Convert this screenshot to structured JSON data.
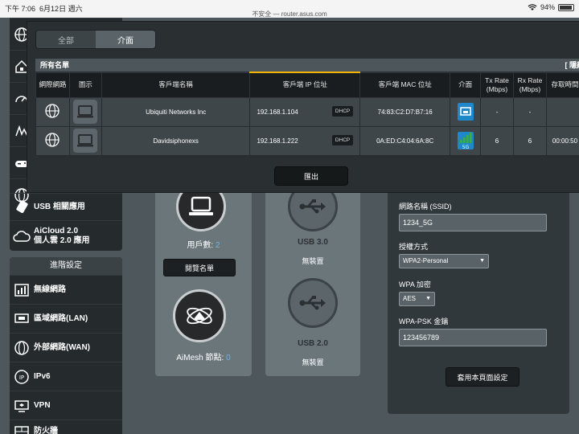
{
  "status_bar": {
    "time": "下午 7:06",
    "date": "6月12日 週六",
    "url": "不安全 — router.asus.com",
    "battery": "94%"
  },
  "sidebar": {
    "items": [
      {
        "label": "",
        "icon": "globe-icon"
      },
      {
        "label": "",
        "icon": "lock-home-icon"
      },
      {
        "label": "",
        "icon": "speedometer-icon"
      },
      {
        "label": "",
        "icon": "signal-icon"
      },
      {
        "label": "",
        "icon": "gamepad-icon"
      },
      {
        "label": "",
        "icon": "globe-icon"
      },
      {
        "label": "USB 相關應用",
        "icon": "usb-icon"
      },
      {
        "label": "AiCloud 2.0\n個人雲 2.0 應用",
        "icon": "cloud-icon"
      }
    ],
    "advanced_header": "進階設定",
    "advanced_items": [
      {
        "label": "無線網路",
        "icon": "wifi-icon"
      },
      {
        "label": "區域網路(LAN)",
        "icon": "lan-icon"
      },
      {
        "label": "外部網路(WAN)",
        "icon": "wan-globe-icon"
      },
      {
        "label": "IPv6",
        "icon": "ipv6-icon"
      },
      {
        "label": "VPN",
        "icon": "vpn-icon"
      },
      {
        "label": "防火牆",
        "icon": "firewall-icon"
      }
    ]
  },
  "clients_panel": {
    "count_label": "用戶數:",
    "count": "2",
    "view_list_button": "閱覽名單",
    "aimesh_label": "AiMesh 節點:",
    "aimesh_count": "0"
  },
  "usb_panel": {
    "usb3_title": "USB 3.0",
    "usb3_status": "無裝置",
    "usb2_title": "USB 2.0",
    "usb2_status": "無裝置"
  },
  "wireless_panel": {
    "ssid_label": "網路名稱 (SSID)",
    "ssid_value": "1234_5G",
    "auth_label": "授權方式",
    "auth_value": "WPA2-Personal",
    "wpa_label": "WPA 加密",
    "wpa_value": "AES",
    "psk_label": "WPA-PSK 金鑰",
    "psk_value": "123456789",
    "apply_button": "套用本頁面設定"
  },
  "modal": {
    "tabs": [
      {
        "label": "全部",
        "active": false
      },
      {
        "label": "介面",
        "active": true
      }
    ],
    "list_title": "所有名單",
    "hide_label": "[ 隱藏",
    "columns": [
      "網際網路",
      "圖示",
      "客戶端名稱",
      "客戶端 IP 位址",
      "客戶端 MAC 位址",
      "介面",
      "Tx Rate\n(Mbps)",
      "Rx Rate\n(Mbps)",
      "存取時間"
    ],
    "rows": [
      {
        "name": "Ubiquiti Networks Inc",
        "ip": "192.168.1.104",
        "ip_type": "DHCP",
        "mac": "74:83:C2:D7:B7:16",
        "iface": "wired",
        "tx": "-",
        "rx": "-",
        "time": ""
      },
      {
        "name": "Davidsiphonexs",
        "ip": "192.168.1.222",
        "ip_type": "DHCP",
        "mac": "0A:ED:C4:04:6A:8C",
        "iface": "5G",
        "tx": "6",
        "rx": "6",
        "time": "00:00:50"
      }
    ],
    "export_button": "匯出"
  },
  "colors": {
    "accent_yellow": "#f5b400",
    "link_blue": "#6fb3e8",
    "wifi_green": "#3fb03f",
    "wired_blue": "#1e88c8"
  }
}
